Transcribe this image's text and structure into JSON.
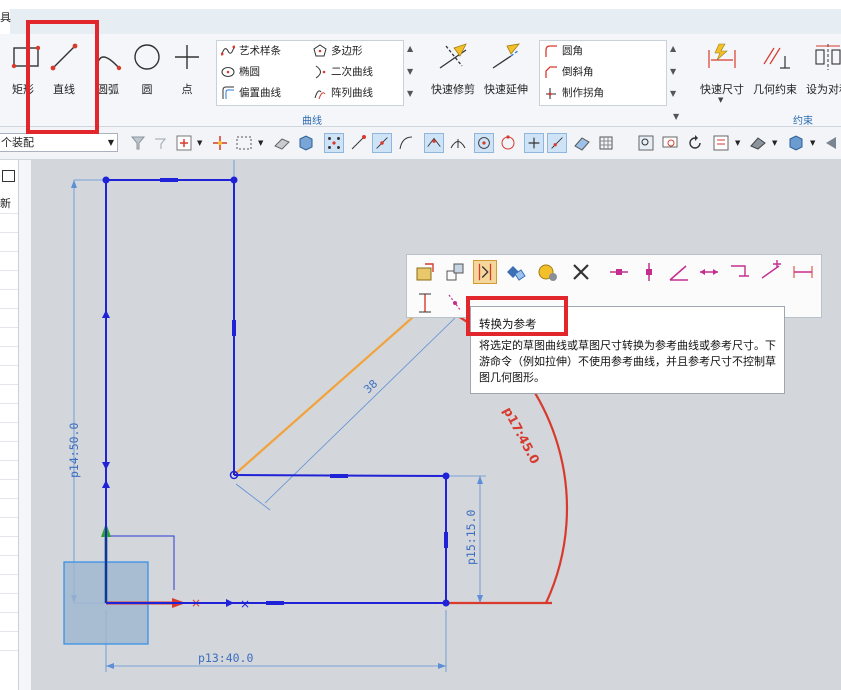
{
  "menubar": {
    "partial_label": "具"
  },
  "ribbon": {
    "big_tools": [
      {
        "label": "矩形",
        "icon": "rectangle-icon"
      },
      {
        "label": "直线",
        "icon": "line-icon"
      },
      {
        "label": "圆弧",
        "icon": "arc-icon"
      },
      {
        "label": "圆",
        "icon": "circle-icon"
      },
      {
        "label": "点",
        "icon": "point-icon"
      }
    ],
    "curve_gallery": {
      "items": [
        "艺术样条",
        "多边形",
        "椭圆",
        "二次曲线",
        "偏置曲线",
        "阵列曲线"
      ],
      "group_label": "曲线"
    },
    "edit_tools": [
      {
        "label": "快速修剪",
        "icon": "quick-trim-icon"
      },
      {
        "label": "快速延伸",
        "icon": "quick-extend-icon"
      }
    ],
    "corner_gallery": {
      "items": [
        "圆角",
        "倒斜角",
        "制作拐角"
      ]
    },
    "constraint_tools": [
      {
        "label": "快速尺寸",
        "icon": "rapid-dimension-icon"
      },
      {
        "label": "几何约束",
        "icon": "geometric-constraint-icon"
      },
      {
        "label": "设为对称",
        "icon": "make-symmetric-icon"
      }
    ],
    "constraint_group_label": "约束"
  },
  "toolbar2": {
    "assembly_select": "个装配"
  },
  "left_panel": {
    "label": "新"
  },
  "sketch": {
    "dimensions": {
      "p14": "p14:50.0",
      "p15": "p15:15.0",
      "p13": "p13:40.0",
      "p17": "p17:45.0",
      "ref": "38"
    }
  },
  "tooltip": {
    "title": "转换为参考",
    "description": "将选定的草图曲线或草图尺寸转换为参考曲线或参考尺寸。下游命令（例如拉伸）不使用参考曲线，并且参考尺寸不控制草图几何图形。"
  },
  "colors": {
    "sketch_blue": "#1f22d6",
    "reference_orange": "#f2a23a",
    "dimension_red": "#d83a2e",
    "highlight_red": "#e1262c",
    "canvas_gray": "#d3d6db"
  }
}
